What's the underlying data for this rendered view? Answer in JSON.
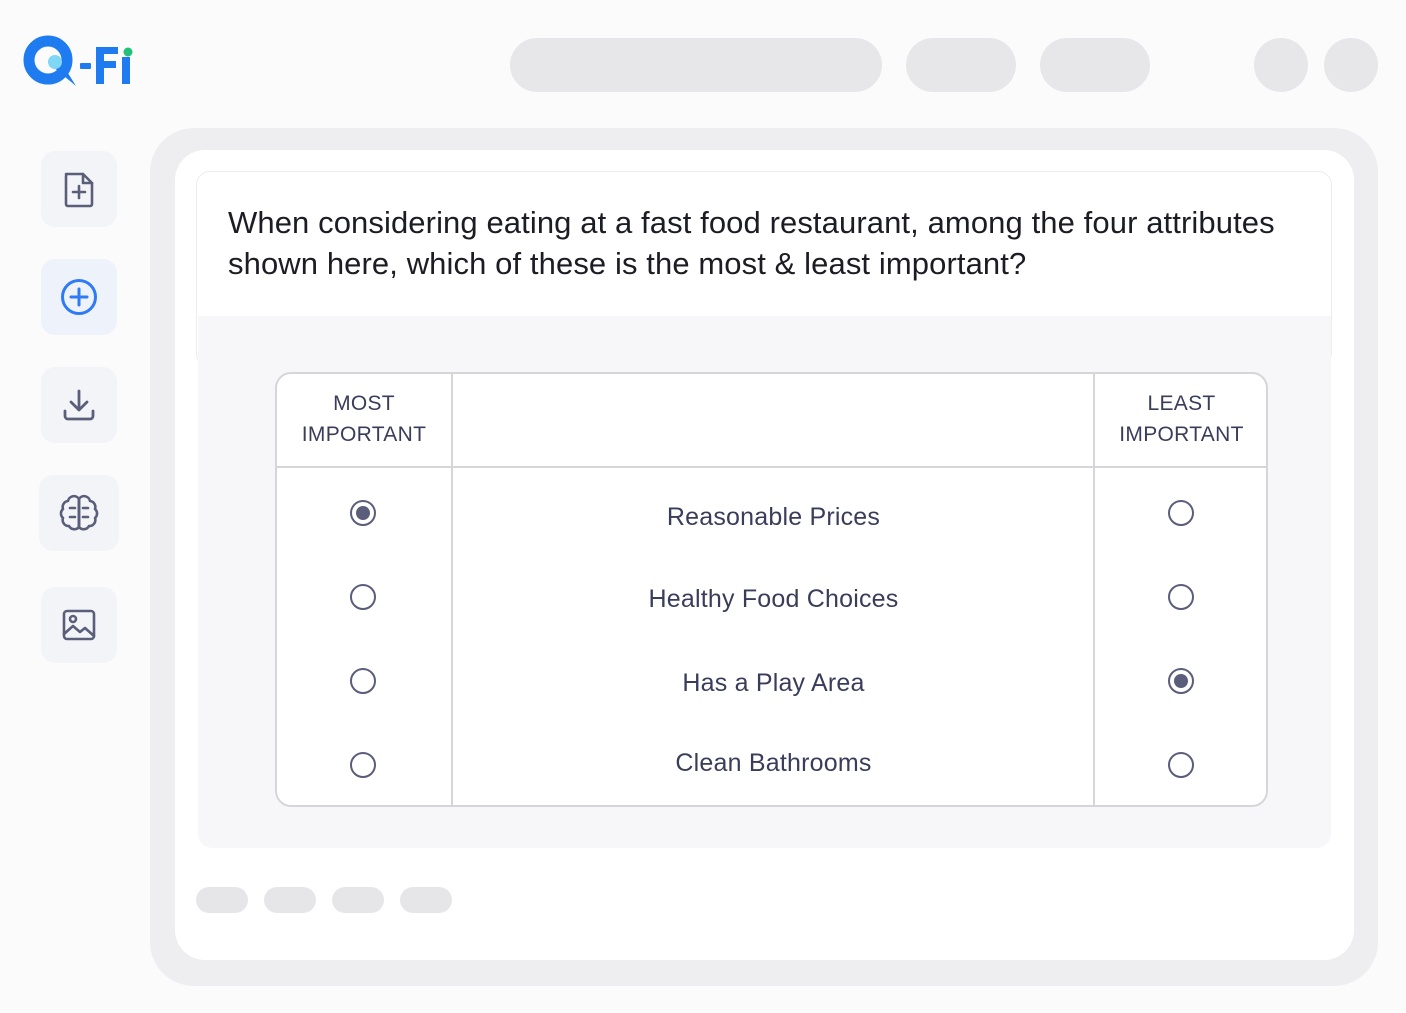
{
  "brand": {
    "logo_text": "Q-Fi",
    "colors": {
      "logo_blue": "#1f7cf0",
      "logo_green": "#22c07a",
      "accent": "#2f7bf6"
    }
  },
  "sidebar": {
    "items": [
      {
        "icon": "file-plus-icon",
        "active": false
      },
      {
        "icon": "plus-circle-icon",
        "active": true
      },
      {
        "icon": "download-icon",
        "active": false
      },
      {
        "icon": "brain-icon",
        "active": false
      },
      {
        "icon": "image-icon",
        "active": false
      }
    ]
  },
  "question": {
    "text": "When considering eating at a fast food restaurant, among the four attributes shown here, which of these is the most & least important?"
  },
  "maxdiff": {
    "most_header": [
      "MOST",
      "IMPORTANT"
    ],
    "least_header": [
      "LEAST",
      "IMPORTANT"
    ],
    "rows": [
      {
        "label": "Reasonable Prices",
        "most": true,
        "least": false
      },
      {
        "label": "Healthy Food Choices",
        "most": false,
        "least": false
      },
      {
        "label": "Has a Play Area",
        "most": false,
        "least": true
      },
      {
        "label": "Clean Bathrooms",
        "most": false,
        "least": false
      }
    ]
  }
}
